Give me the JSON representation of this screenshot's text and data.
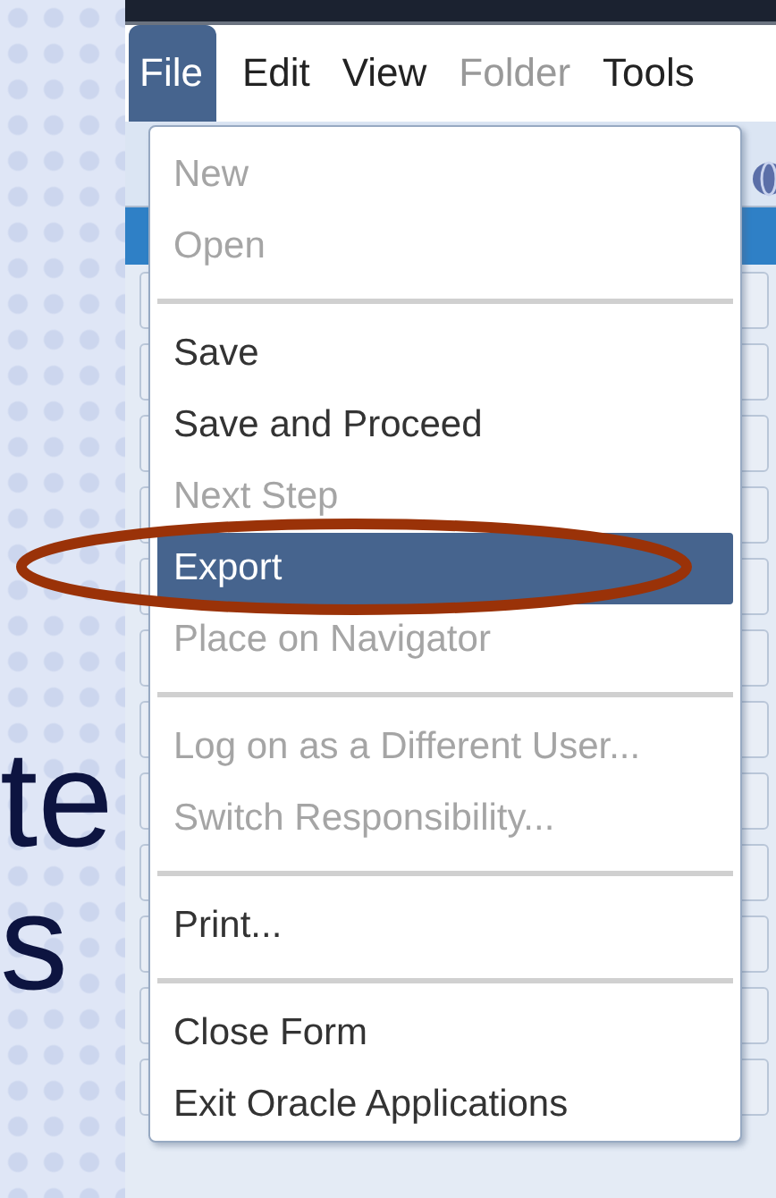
{
  "slide": {
    "text_lines": [
      "te",
      "s"
    ]
  },
  "menu_bar": [
    {
      "label": "File",
      "selected": true,
      "disabled": false
    },
    {
      "label": "Edit",
      "selected": false,
      "disabled": false
    },
    {
      "label": "View",
      "selected": false,
      "disabled": false
    },
    {
      "label": "Folder",
      "selected": false,
      "disabled": true
    },
    {
      "label": "Tools",
      "selected": false,
      "disabled": false
    }
  ],
  "file_menu": [
    {
      "kind": "item",
      "label": "New",
      "disabled": true,
      "selected": false
    },
    {
      "kind": "item",
      "label": "Open",
      "disabled": true,
      "selected": false
    },
    {
      "kind": "separator"
    },
    {
      "kind": "item",
      "label": "Save",
      "disabled": false,
      "selected": false
    },
    {
      "kind": "item",
      "label": "Save and Proceed",
      "disabled": false,
      "selected": false
    },
    {
      "kind": "item",
      "label": "Next Step",
      "disabled": true,
      "selected": false
    },
    {
      "kind": "item",
      "label": "Export",
      "disabled": false,
      "selected": true
    },
    {
      "kind": "item",
      "label": "Place on Navigator",
      "disabled": true,
      "selected": false
    },
    {
      "kind": "separator"
    },
    {
      "kind": "item",
      "label": "Log on as a Different User...",
      "disabled": true,
      "selected": false
    },
    {
      "kind": "item",
      "label": "Switch Responsibility...",
      "disabled": true,
      "selected": false
    },
    {
      "kind": "separator"
    },
    {
      "kind": "item",
      "label": "Print...",
      "disabled": false,
      "selected": false
    },
    {
      "kind": "separator"
    },
    {
      "kind": "item",
      "label": "Close Form",
      "disabled": false,
      "selected": false
    },
    {
      "kind": "item",
      "label": "Exit Oracle Applications",
      "disabled": false,
      "selected": false
    }
  ]
}
